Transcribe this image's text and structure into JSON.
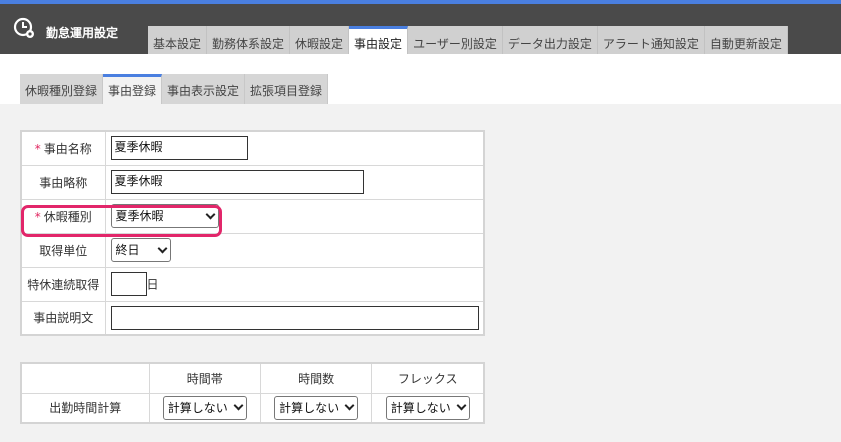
{
  "app": {
    "title": "勤怠運用設定",
    "icon": "clock-gear-icon"
  },
  "main_tabs": [
    {
      "label": "基本設定",
      "active": false
    },
    {
      "label": "勤務体系設定",
      "active": false
    },
    {
      "label": "休暇設定",
      "active": false
    },
    {
      "label": "事由設定",
      "active": true
    },
    {
      "label": "ユーザー別設定",
      "active": false
    },
    {
      "label": "データ出力設定",
      "active": false
    },
    {
      "label": "アラート通知設定",
      "active": false
    },
    {
      "label": "自動更新設定",
      "active": false
    }
  ],
  "sub_tabs": [
    {
      "label": "休暇種別登録",
      "active": false
    },
    {
      "label": "事由登録",
      "active": true
    },
    {
      "label": "事由表示設定",
      "active": false
    },
    {
      "label": "拡張項目登録",
      "active": false
    }
  ],
  "form": {
    "required_mark": "*",
    "reason_name": {
      "label": "事由名称",
      "value": "夏季休暇"
    },
    "reason_short": {
      "label": "事由略称",
      "value": "夏季休暇"
    },
    "leave_type": {
      "label": "休暇種別",
      "value": "夏季休暇"
    },
    "unit": {
      "label": "取得単位",
      "value": "終日"
    },
    "consecutive": {
      "label": "特休連続取得",
      "value": "",
      "suffix": "日"
    },
    "description": {
      "label": "事由説明文",
      "value": ""
    }
  },
  "calc": {
    "headers": [
      "時間帯",
      "時間数",
      "フレックス"
    ],
    "row_label": "出勤時間計算",
    "values": [
      "計算しない",
      "計算しない",
      "計算しない"
    ]
  },
  "colors": {
    "accent": "#4a7fe0",
    "highlight": "#e2266a",
    "required": "#e0245e",
    "topbar": "#4a4a4a"
  }
}
